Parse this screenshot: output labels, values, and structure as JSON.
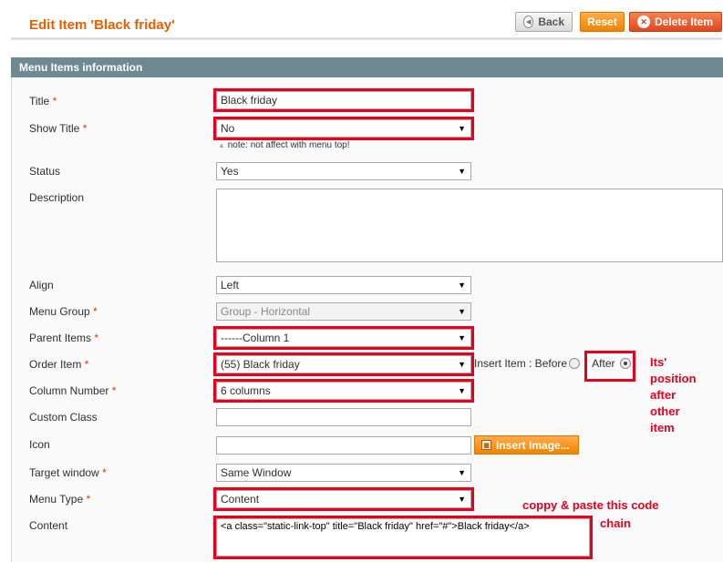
{
  "header": {
    "title": "Edit Item 'Black friday'",
    "back_label": "Back",
    "reset_label": "Reset",
    "delete_label": "Delete Item"
  },
  "section": {
    "title": "Menu Items information"
  },
  "fields": {
    "title": {
      "label": "Title",
      "value": "Black friday"
    },
    "show_title": {
      "label": "Show Title",
      "value": "No",
      "note": "note: not affect with menu top!"
    },
    "status": {
      "label": "Status",
      "value": "Yes"
    },
    "description": {
      "label": "Description",
      "value": ""
    },
    "align": {
      "label": "Align",
      "value": "Left"
    },
    "menu_group": {
      "label": "Menu Group",
      "value": "Group - Horizontal"
    },
    "parent_items": {
      "label": "Parent Items",
      "value": "------Column 1"
    },
    "order_item": {
      "label": "Order Item",
      "value": "(55) Black friday",
      "insert_label": "Insert Item : Before",
      "separator": "|",
      "after_label": "After"
    },
    "column_number": {
      "label": "Column Number",
      "value": "6 columns"
    },
    "custom_class": {
      "label": "Custom Class",
      "value": ""
    },
    "icon": {
      "label": "Icon",
      "value": "",
      "button_label": "Insert Image..."
    },
    "target_window": {
      "label": "Target window",
      "value": "Same Window"
    },
    "menu_type": {
      "label": "Menu Type",
      "value": "Content"
    },
    "content": {
      "label": "Content",
      "value": "<a class=\"static-link-top\" title=\"Black friday\" href=\"#\">Black friday</a>"
    }
  },
  "required_mark": "*",
  "annotations": {
    "position": [
      "Its'",
      "position",
      "after",
      "other",
      "item"
    ],
    "copy_line1": "coppy & paste this code",
    "copy_line2": "chain"
  },
  "colors": {
    "title": "#eb5e00",
    "highlight": "#e8001c",
    "section_header": "#6f8992"
  }
}
